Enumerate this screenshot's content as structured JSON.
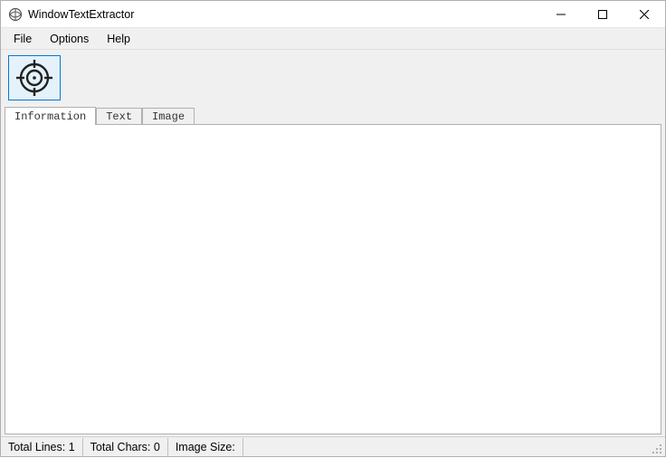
{
  "window": {
    "title": "WindowTextExtractor"
  },
  "menu": {
    "file": "File",
    "options": "Options",
    "help": "Help"
  },
  "tabs": {
    "information": "Information",
    "text": "Text",
    "image": "Image"
  },
  "status": {
    "total_lines_label": "Total Lines:",
    "total_lines_value": "1",
    "total_chars_label": "Total Chars:",
    "total_chars_value": "0",
    "image_size_label": "Image Size:",
    "image_size_value": ""
  }
}
